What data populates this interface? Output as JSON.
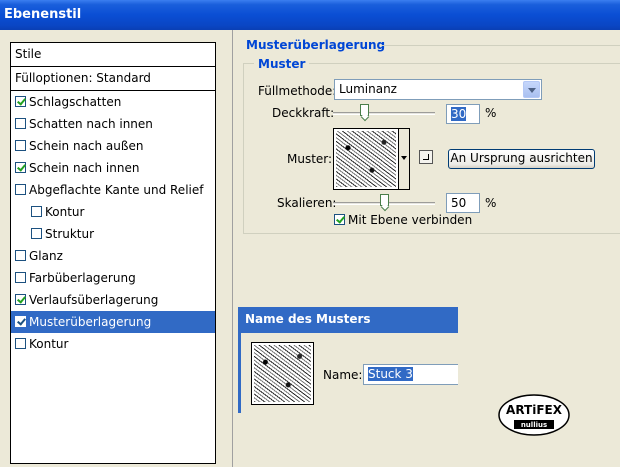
{
  "window": {
    "title": "Ebenenstil"
  },
  "left_panel": {
    "header": "Stile",
    "blend_options": "Fülloptionen: Standard",
    "items": [
      {
        "label": "Schlagschatten",
        "checked": true,
        "indent": false,
        "selected": false
      },
      {
        "label": "Schatten nach innen",
        "checked": false,
        "indent": false,
        "selected": false
      },
      {
        "label": "Schein nach außen",
        "checked": false,
        "indent": false,
        "selected": false
      },
      {
        "label": "Schein nach innen",
        "checked": true,
        "indent": false,
        "selected": false
      },
      {
        "label": "Abgeflachte Kante und Relief",
        "checked": false,
        "indent": false,
        "selected": false
      },
      {
        "label": "Kontur",
        "checked": false,
        "indent": true,
        "selected": false
      },
      {
        "label": "Struktur",
        "checked": false,
        "indent": true,
        "selected": false
      },
      {
        "label": "Glanz",
        "checked": false,
        "indent": false,
        "selected": false
      },
      {
        "label": "Farbüberlagerung",
        "checked": false,
        "indent": false,
        "selected": false
      },
      {
        "label": "Verlaufsüberlagerung",
        "checked": true,
        "indent": false,
        "selected": false
      },
      {
        "label": "Musterüberlagerung",
        "checked": true,
        "indent": false,
        "selected": true
      },
      {
        "label": "Kontur",
        "checked": false,
        "indent": false,
        "selected": false
      }
    ]
  },
  "settings": {
    "section_title": "Musterüberlagerung",
    "group_title": "Muster",
    "blend_mode_label": "Füllmethode:",
    "blend_mode_value": "Luminanz",
    "opacity_label": "Deckkraft:",
    "opacity_value": "30",
    "opacity_level": 0.3,
    "percent": "%",
    "pattern_label": "Muster:",
    "snap_origin_button": "An Ursprung ausrichten",
    "scale_label": "Skalieren:",
    "scale_value": "50",
    "scale_level": 0.5,
    "link_layer_label": "Mit Ebene verbinden",
    "link_layer_checked": true
  },
  "pattern_name_panel": {
    "title": "Name des Musters",
    "name_label": "Name:",
    "name_value": "Stuck 3"
  },
  "logo": {
    "line1": "ARTiFEX",
    "line2": "nullius"
  },
  "colors": {
    "titlebar": "#0a4ed4",
    "accent": "#316ac5",
    "section_title": "#0046d5",
    "window_bg": "#ece9d8"
  }
}
